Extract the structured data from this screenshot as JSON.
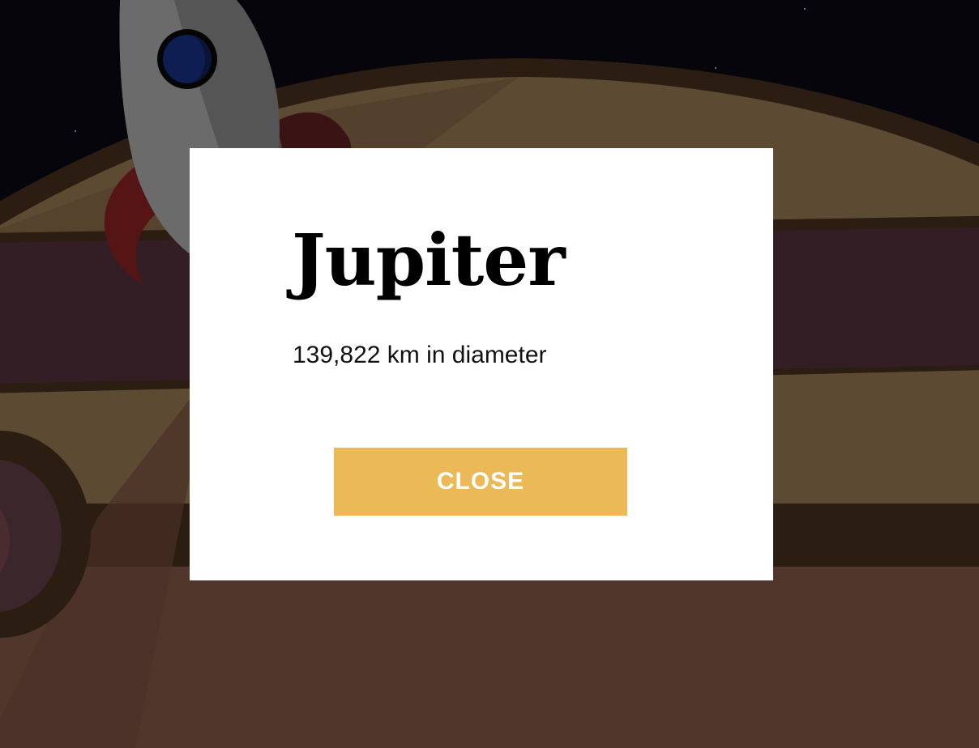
{
  "modal": {
    "title": "Jupiter",
    "description": "139,822 km in diameter",
    "close_label": "CLOSE"
  },
  "colors": {
    "space": "#05050b",
    "planet_light": "#5c4a33",
    "planet_dark_band": "#2b1d12",
    "planet_purple_band": "#321e24",
    "planet_lower": "#51362c",
    "button": "#ebb956",
    "modal_bg": "#ffffff"
  },
  "icons": {
    "rocket": "rocket-icon",
    "planet": "jupiter-planet"
  }
}
